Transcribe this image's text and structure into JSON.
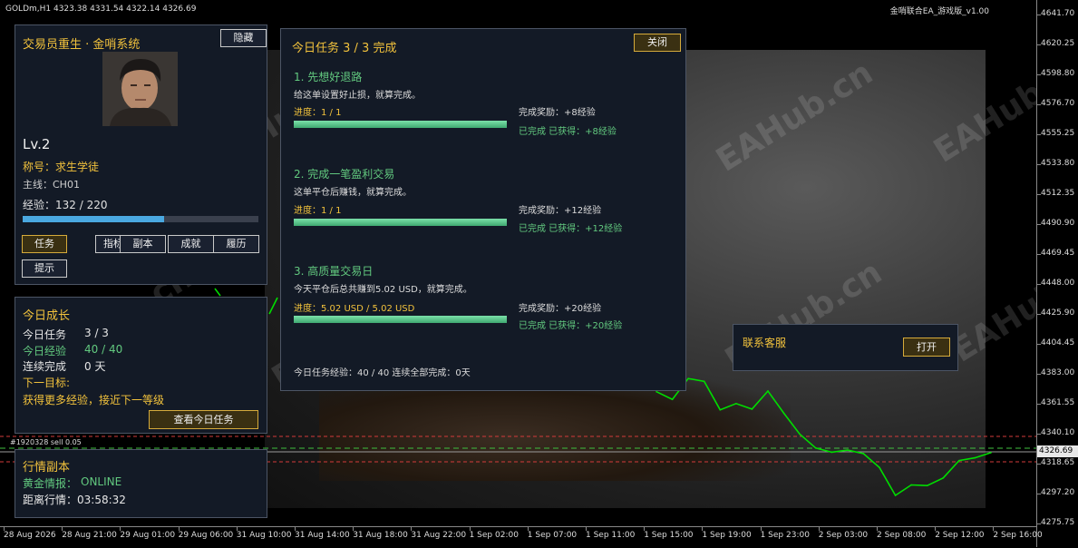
{
  "chart": {
    "header_left": "GOLDm,H1  4323.38 4331.54 4322.14 4326.69",
    "header_right": "金哨联合EA_游戏版_v1.00",
    "order_label": "#1920328 sell 0.05",
    "current_price": "4326.69",
    "price_labels": [
      "4641.70",
      "4620.25",
      "4598.80",
      "4576.70",
      "4555.25",
      "4533.80",
      "4512.35",
      "4490.90",
      "4469.45",
      "4448.00",
      "4425.90",
      "4404.45",
      "4383.00",
      "4361.55",
      "4340.10",
      "4318.65",
      "4297.20",
      "4275.75"
    ],
    "time_labels": [
      "28 Aug 2026",
      "28 Aug 21:00",
      "29 Aug 01:00",
      "29 Aug 06:00",
      "31 Aug 10:00",
      "31 Aug 14:00",
      "31 Aug 18:00",
      "31 Aug 22:00",
      "1 Sep 02:00",
      "1 Sep 07:00",
      "1 Sep 11:00",
      "1 Sep 15:00",
      "1 Sep 19:00",
      "1 Sep 23:00",
      "2 Sep 03:00",
      "2 Sep 08:00",
      "2 Sep 12:00",
      "2 Sep 16:00"
    ],
    "watermark": "EAHub.cn"
  },
  "chart_data": {
    "type": "line",
    "title": "",
    "xlabel": "",
    "ylabel": "",
    "ylim": [
      4275.75,
      4641.7
    ],
    "visible_series_y": [
      4370.5,
      4365.0,
      4380.0,
      4378.0,
      4357.5,
      4362.0,
      4358.0,
      4371.0,
      4355.0,
      4340.0,
      4330.0,
      4327.0,
      4328.5,
      4326.0,
      4316.0,
      4296.0,
      4303.5,
      4303.0,
      4308.5,
      4321.0,
      4323.0,
      4326.7
    ],
    "colors": {
      "line": "#00dd00",
      "bg": "#000000"
    }
  },
  "profile": {
    "title": "交易员重生 · 金哨系统",
    "hide_label": "隐藏",
    "level": "Lv.2",
    "rank": "称号：求生学徒",
    "mainline": "主线：CH01",
    "exp_text": "经验：132 / 220",
    "exp_fraction": 0.6,
    "buttons": [
      "任务",
      "指标库",
      "副本",
      "成就",
      "履历"
    ],
    "hint_label": "提示"
  },
  "growth": {
    "title": "今日成长",
    "tasks_label": "今日任务",
    "tasks_value": "3 / 3",
    "exp_label": "今日经验",
    "exp_value": "40 / 40",
    "streak_label": "连续完成",
    "streak_value": "0 天",
    "next_label": "下一目标:",
    "next_text": "获得更多经验，接近下一等级",
    "view_button": "查看今日任务"
  },
  "market": {
    "title": "行情副本",
    "gold_label": "黄金情报：",
    "gold_status": "ONLINE",
    "countdown": "距离行情：03:58:32"
  },
  "tasks_panel": {
    "title": "今日任务  3 / 3 完成",
    "close_label": "关闭",
    "tasks": [
      {
        "name": "1. 先想好退路",
        "desc": "给这单设置好止损，就算完成。",
        "progress": "进度：1 / 1",
        "progress_fraction": 1.0,
        "reward": "完成奖励：+8经验",
        "status": "已完成  已获得：+8经验"
      },
      {
        "name": "2. 完成一笔盈利交易",
        "desc": "这单平仓后赚钱，就算完成。",
        "progress": "进度：1 / 1",
        "progress_fraction": 1.0,
        "reward": "完成奖励：+12经验",
        "status": "已完成  已获得：+12经验"
      },
      {
        "name": "3. 高质量交易日",
        "desc": "今天平仓后总共赚到5.02 USD，就算完成。",
        "progress": "进度：5.02 USD / 5.02 USD",
        "progress_fraction": 1.0,
        "reward": "完成奖励：+20经验",
        "status": "已完成  已获得：+20经验"
      }
    ],
    "footer": "今日任务经验：40 / 40    连续全部完成：0天"
  },
  "support": {
    "title": "联系客服",
    "open_label": "打开"
  }
}
